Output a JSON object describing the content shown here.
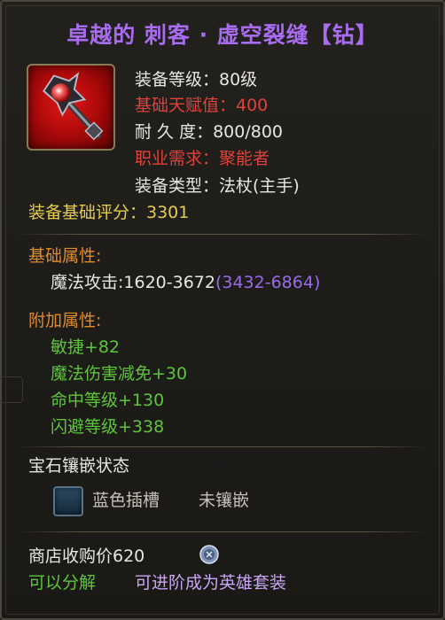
{
  "item": {
    "title": "卓越的 刺客 · 虚空裂缝【钻】",
    "equip_level": "装备等级：80级",
    "talent_value": "基础天赋值：400",
    "durability": "耐 久 度：800/800",
    "class_req": "职业需求：聚能者",
    "equip_type": "装备类型：法杖(主手)",
    "base_score": "装备基础评分：3301"
  },
  "base_attr": {
    "header": "基础属性:",
    "magic_attack": "魔法攻击:1620-3672",
    "magic_attack_bonus": "(3432-6864)"
  },
  "extra_attr": {
    "header": "附加属性:",
    "items": [
      "敏捷+82",
      "魔法伤害减免+30",
      "命中等级+130",
      "闪避等级+338"
    ]
  },
  "gem": {
    "header": "宝石镶嵌状态",
    "slot_label": "蓝色插槽",
    "slot_status": "未镶嵌"
  },
  "footer": {
    "sell_price": "商店收购价620",
    "decompose": "可以分解",
    "upgrade": "可进阶成为英雄套装"
  },
  "icons": {
    "item_icon": "staff-icon",
    "socket_icon": "blue-socket-icon",
    "coin_icon": "silver-coin-icon"
  },
  "colors": {
    "title": "#a86cf0",
    "red": "#e0413a",
    "yellow": "#e6cc4a",
    "orange": "#e08a28",
    "green": "#5ec43a",
    "purple": "#9a6be8"
  }
}
